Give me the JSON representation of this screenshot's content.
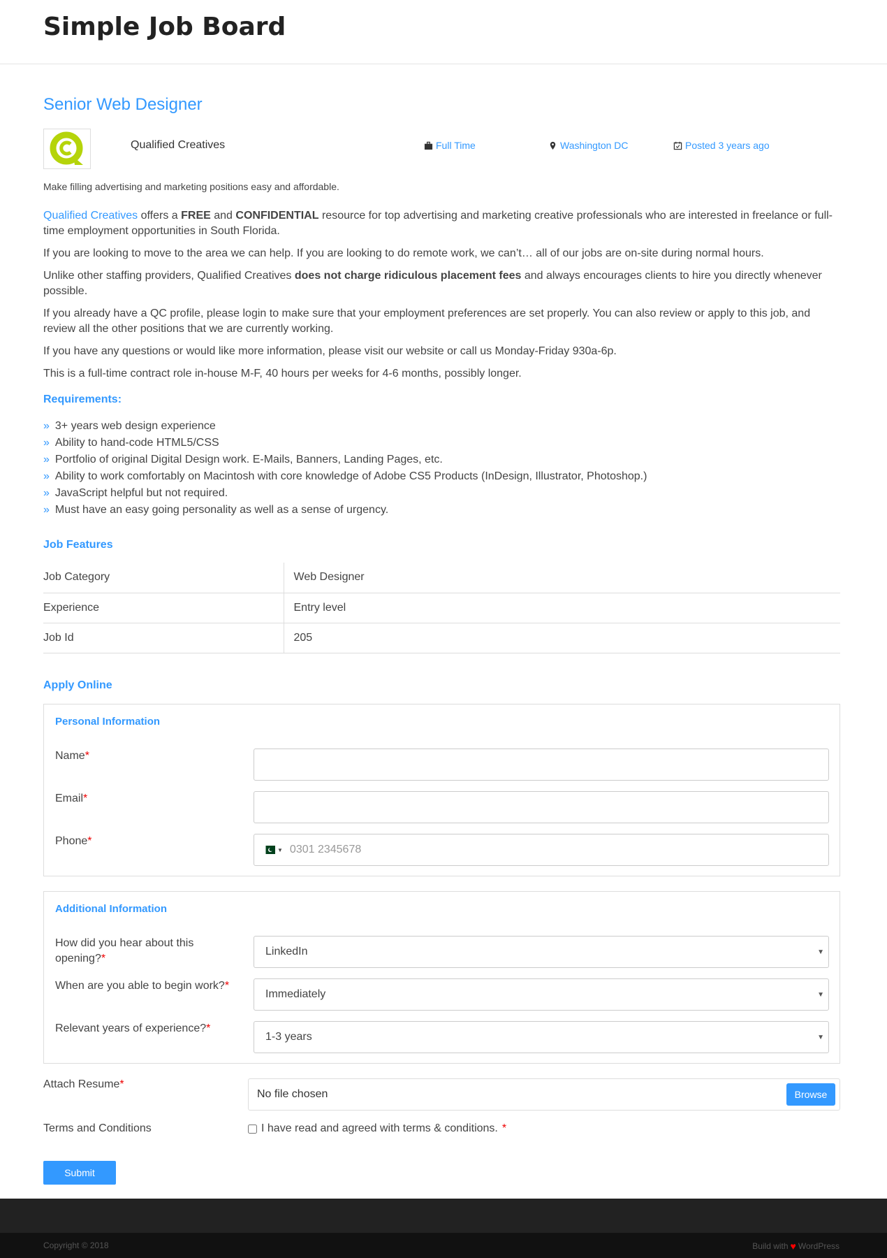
{
  "site": {
    "title": "Simple Job Board"
  },
  "job": {
    "title": "Senior Web Designer",
    "company": "Qualified Creatives",
    "type": "Full Time",
    "location": "Washington DC",
    "posted": "Posted 3 years ago",
    "tagline": "Make filling advertising and marketing positions easy and affordable.",
    "logo_icon": "qc-logo",
    "accent": "#3399ff"
  },
  "description": {
    "p1": {
      "link": "Qualified Creatives",
      "t1": " offers a ",
      "b1": "FREE",
      "t2": " and ",
      "b2": "CONFIDENTIAL",
      "t3": " resource for top advertising and marketing creative professionals who are interested in freelance or full-time employment opportunities in South Florida."
    },
    "p2": "If you are looking to move to the area we can help. If you are looking to do remote work, we can’t… all of our jobs are on-site during normal hours.",
    "p3": {
      "t1": "Unlike other staffing providers, Qualified Creatives ",
      "b1": "does not charge ridiculous placement fees",
      "t2": " and always encourages clients to hire you directly whenever possible."
    },
    "p4": "If you already have a QC profile, please login to make sure that your employment preferences are set properly. You can also review or apply to this job, and review all the other positions that we are currently working.",
    "p5": "If you have any questions or would like more information, please visit our website or call us Monday-Friday 930a-6p.",
    "p6": "This is a full-time contract role in-house M-F, 40 hours per weeks for 4-6 months, possibly longer."
  },
  "requirements": {
    "heading": "Requirements:",
    "items": [
      "3+ years web design experience",
      "Ability to hand-code HTML5/CSS",
      "Portfolio of original Digital Design work. E-Mails, Banners, Landing Pages, etc.",
      "Ability to work comfortably on Macintosh with core knowledge of Adobe CS5 Products (InDesign, Illustrator, Photoshop.)",
      "JavaScript helpful but not required.",
      "Must have an easy going personality as well as a sense of urgency."
    ]
  },
  "features": {
    "heading": "Job Features",
    "rows": [
      [
        "Job Category",
        "Web Designer"
      ],
      [
        "Experience",
        "Entry level"
      ],
      [
        "Job Id",
        "205"
      ]
    ]
  },
  "apply": {
    "heading": "Apply Online",
    "personal": {
      "heading": "Personal Information",
      "name_label": "Name",
      "email_label": "Email",
      "phone_label": "Phone",
      "phone_placeholder": "0301 2345678",
      "phone_flag": "pk-flag"
    },
    "additional": {
      "heading": "Additional Information",
      "q1": "How did you hear about this opening?",
      "a1": "LinkedIn",
      "q2": "When are you able to begin work?",
      "a2": "Immediately",
      "q3": "Relevant years of experience?",
      "a3": "1-3 years"
    },
    "resume_label": "Attach Resume",
    "file_status": "No file chosen",
    "browse": "Browse",
    "terms_label": "Terms and Conditions",
    "terms_text": "I have read and agreed with terms & conditions.",
    "terms_checked": false,
    "required_mark": "*",
    "submit": "Submit"
  },
  "footer": {
    "copyright": "Copyright © 2018",
    "build_pre": "Build with",
    "build_post": "WordPress",
    "heart_color": "#ff0000"
  }
}
